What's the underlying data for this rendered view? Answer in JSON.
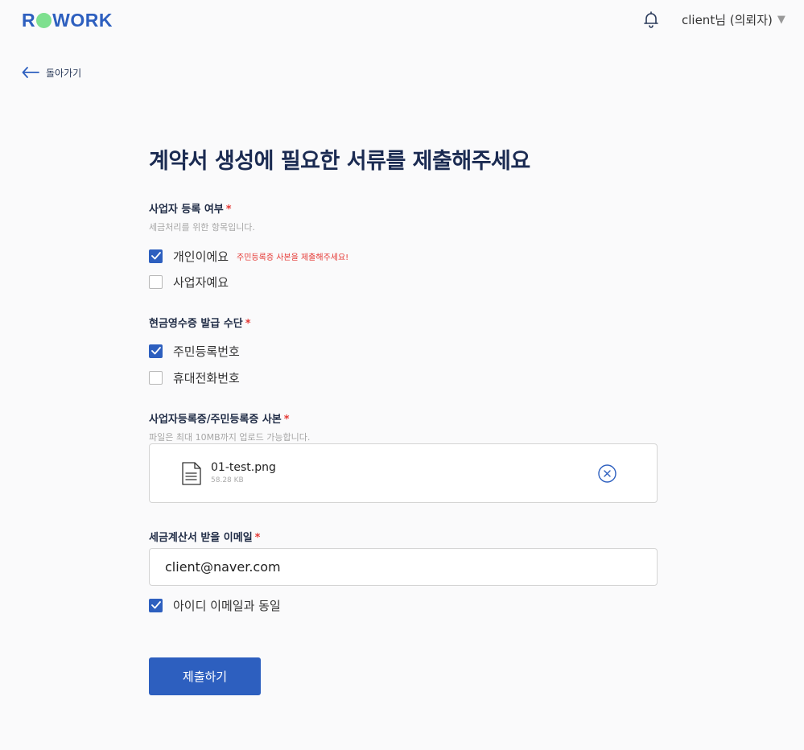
{
  "header": {
    "logo_left": "R",
    "logo_right": "WORK",
    "user_label": "client님 (의뢰자)",
    "caret": "▼"
  },
  "nav": {
    "back_label": "돌아가기"
  },
  "page_title": "계약서 생성에 필요한 서류를 제출해주세요",
  "business": {
    "label": "사업자 등록 여부",
    "required": "*",
    "hint": "세금처리를 위한 항목입니다.",
    "options": [
      {
        "label": "개인이에요",
        "checked": true,
        "warning": "주민등록증 사본을 제출해주세요!"
      },
      {
        "label": "사업자예요",
        "checked": false
      }
    ]
  },
  "receipt": {
    "label": "현금영수증 발급 수단",
    "required": "*",
    "options": [
      {
        "label": "주민등록번호",
        "checked": true
      },
      {
        "label": "휴대전화번호",
        "checked": false
      }
    ]
  },
  "document": {
    "label": "사업자등록증/주민등록증 사본",
    "required": "*",
    "hint": "파일은 최대 10MB까지 업로드 가능합니다.",
    "file": {
      "name": "01-test.png",
      "size": "58.28 KB"
    }
  },
  "email": {
    "label": "세금계산서 받을 이메일",
    "required": "*",
    "value": "client@naver.com",
    "same_as_id": {
      "label": "아이디 이메일과 동일",
      "checked": true
    }
  },
  "submit_label": "제출하기",
  "colors": {
    "primary": "#2d5fbf",
    "logo_dot": "#7ee08f",
    "required": "#e53935",
    "title": "#1b2b52"
  }
}
